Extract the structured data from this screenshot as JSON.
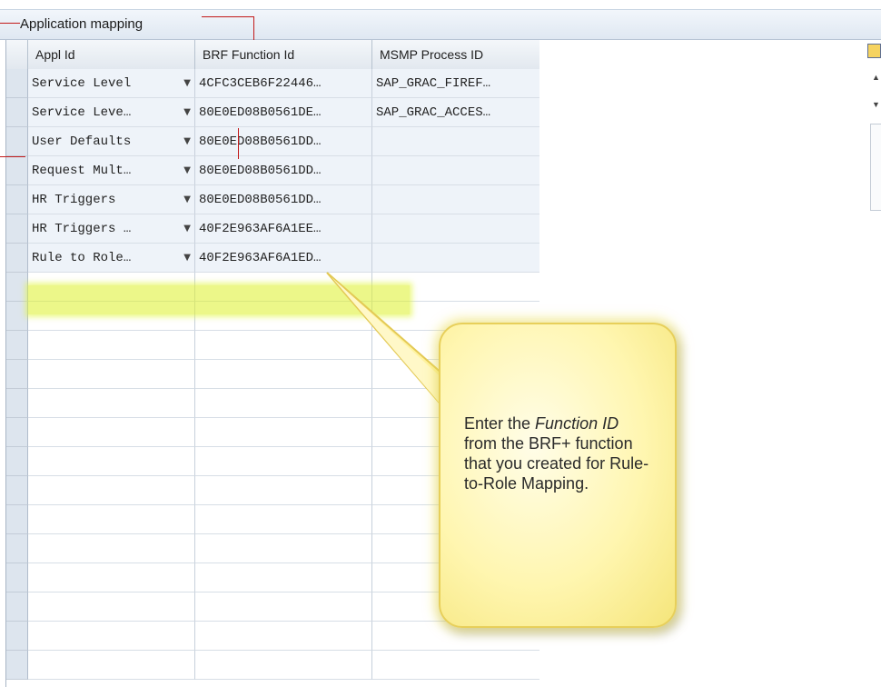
{
  "app": {
    "title": "Application mapping"
  },
  "table": {
    "columns": [
      "Appl Id",
      "BRF Function Id",
      "MSMP Process ID"
    ],
    "rows": [
      {
        "appl": "Service Level",
        "brf": "4CFC3CEB6F22446…",
        "msmp": "SAP_GRAC_FIREF…"
      },
      {
        "appl": "Service Leve…",
        "brf": "80E0ED08B0561DE…",
        "msmp": "SAP_GRAC_ACCES…"
      },
      {
        "appl": "User Defaults",
        "brf": "80E0ED08B0561DD…",
        "msmp": ""
      },
      {
        "appl": "Request Mult…",
        "brf": "80E0ED08B0561DD…",
        "msmp": ""
      },
      {
        "appl": "HR Triggers",
        "brf": "80E0ED08B0561DD…",
        "msmp": ""
      },
      {
        "appl": "HR Triggers …",
        "brf": "40F2E963AF6A1EE…",
        "msmp": ""
      },
      {
        "appl": "Rule to Role…",
        "brf": "40F2E963AF6A1ED…",
        "msmp": ""
      }
    ],
    "empty_row_count": 14
  },
  "callout": {
    "prefix": "Enter the ",
    "emphasis": "Function ID",
    "suffix": " from the BRF+ function that you created for Rule-to-Role Mapping."
  },
  "colors": {
    "highlight": "#dcf028",
    "callout_fill": "#fff6b0",
    "annotation_line": "#c21a1a"
  },
  "icons": [
    "dropdown-arrow-icon",
    "layout-icon",
    "scroll-up-icon",
    "scroll-down-icon"
  ]
}
